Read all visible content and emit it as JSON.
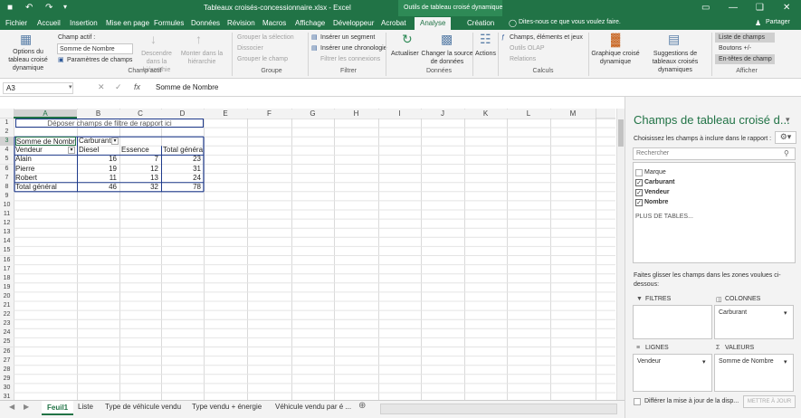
{
  "titlebar": {
    "title": "Tableaux croisés-concessionnaire.xlsx - Excel",
    "context_title": "Outils de tableau croisé dynamique",
    "share": "Partager",
    "tell_me": "Dites-nous ce que vous voulez faire."
  },
  "tabs": [
    "Fichier",
    "Accueil",
    "Insertion",
    "Mise en page",
    "Formules",
    "Données",
    "Révision",
    "Macros",
    "Affichage",
    "Développeur",
    "Acrobat",
    "Analyse",
    "Création"
  ],
  "active_tab": "Analyse",
  "ribbon": {
    "options_label": "Options du tableau croisé dynamique",
    "active_field_label": "Champ actif :",
    "active_field_value": "Somme de Nombre",
    "field_settings": "Paramètres de champs",
    "drill_down": "Descendre dans la hiérarchie",
    "drill_up": "Monter dans la hiérarchie",
    "group_selection": "Grouper la sélection",
    "ungroup": "Dissocier",
    "group_field": "Grouper le champ",
    "insert_slicer": "Insérer un segment",
    "insert_timeline": "Insérer une chronologie",
    "filter_connections": "Filtrer les connexions",
    "refresh": "Actualiser",
    "change_source": "Changer la source de données",
    "actions": "Actions",
    "fields_items_sets": "Champs, éléments et jeux",
    "olap_tools": "Outils OLAP",
    "relations": "Relations",
    "pivot_chart": "Graphique croisé dynamique",
    "recommended": "Suggestions de tableaux croisés dynamiques",
    "field_list": "Liste de champs",
    "buttons": "Boutons +/-",
    "field_headers": "En-têtes de champ",
    "groups": {
      "active_field": "Champ actif",
      "group": "Groupe",
      "filter": "Filtrer",
      "data": "Données",
      "calculations": "Calculs",
      "show": "Afficher"
    }
  },
  "formula": {
    "name_box": "A3",
    "content": "Somme de Nombre",
    "fx": "fx"
  },
  "columns": [
    "A",
    "B",
    "C",
    "D",
    "E",
    "F",
    "G",
    "H",
    "I",
    "J",
    "K",
    "L",
    "M"
  ],
  "rows": [
    "1",
    "2",
    "3",
    "4",
    "5",
    "6",
    "7",
    "8",
    "9",
    "10",
    "11",
    "12",
    "13",
    "14",
    "15",
    "16",
    "17",
    "18",
    "19",
    "20",
    "21",
    "22",
    "23",
    "24",
    "25",
    "26",
    "27",
    "28",
    "29",
    "30",
    "31"
  ],
  "pivot": {
    "filter_drop": "Déposer champs de filtre de rapport ici",
    "value_label": "Somme de Nombre",
    "col_field": "Carburant",
    "row_field": "Vendeur",
    "col_headers": [
      "Diesel",
      "Essence",
      "Total général"
    ],
    "rows": [
      {
        "label": "Alain",
        "values": [
          "16",
          "7",
          "23"
        ]
      },
      {
        "label": "Pierre",
        "values": [
          "19",
          "12",
          "31"
        ]
      },
      {
        "label": "Robert",
        "values": [
          "11",
          "13",
          "24"
        ]
      },
      {
        "label": "Total général",
        "values": [
          "46",
          "32",
          "78"
        ]
      }
    ]
  },
  "pane": {
    "title": "Champs de tableau croisé d...",
    "subtitle": "Choisissez les champs à inclure dans le rapport :",
    "search_placeholder": "Rechercher",
    "fields": [
      {
        "name": "Marque",
        "checked": false
      },
      {
        "name": "Carburant",
        "checked": true
      },
      {
        "name": "Vendeur",
        "checked": true
      },
      {
        "name": "Nombre",
        "checked": true
      }
    ],
    "more_tables": "PLUS DE TABLES...",
    "drag_hint": "Faites glisser les champs dans les zones voulues ci-dessous:",
    "filters_label": "FILTRES",
    "columns_label": "COLONNES",
    "rows_label": "LIGNES",
    "values_label": "VALEURS",
    "columns_value": "Carburant",
    "rows_value": "Vendeur",
    "values_value": "Somme de Nombre",
    "defer": "Différer la mise à jour de la disp...",
    "update": "METTRE À JOUR"
  },
  "sheets": [
    "Feuil1",
    "Liste",
    "Type de véhicule vendu",
    "Type vendu + énergie",
    "Véhicule  vendu par é ..."
  ],
  "active_sheet": "Feuil1",
  "colors": {
    "excel_green": "#217346",
    "pivot_border": "#1f3b8c"
  }
}
